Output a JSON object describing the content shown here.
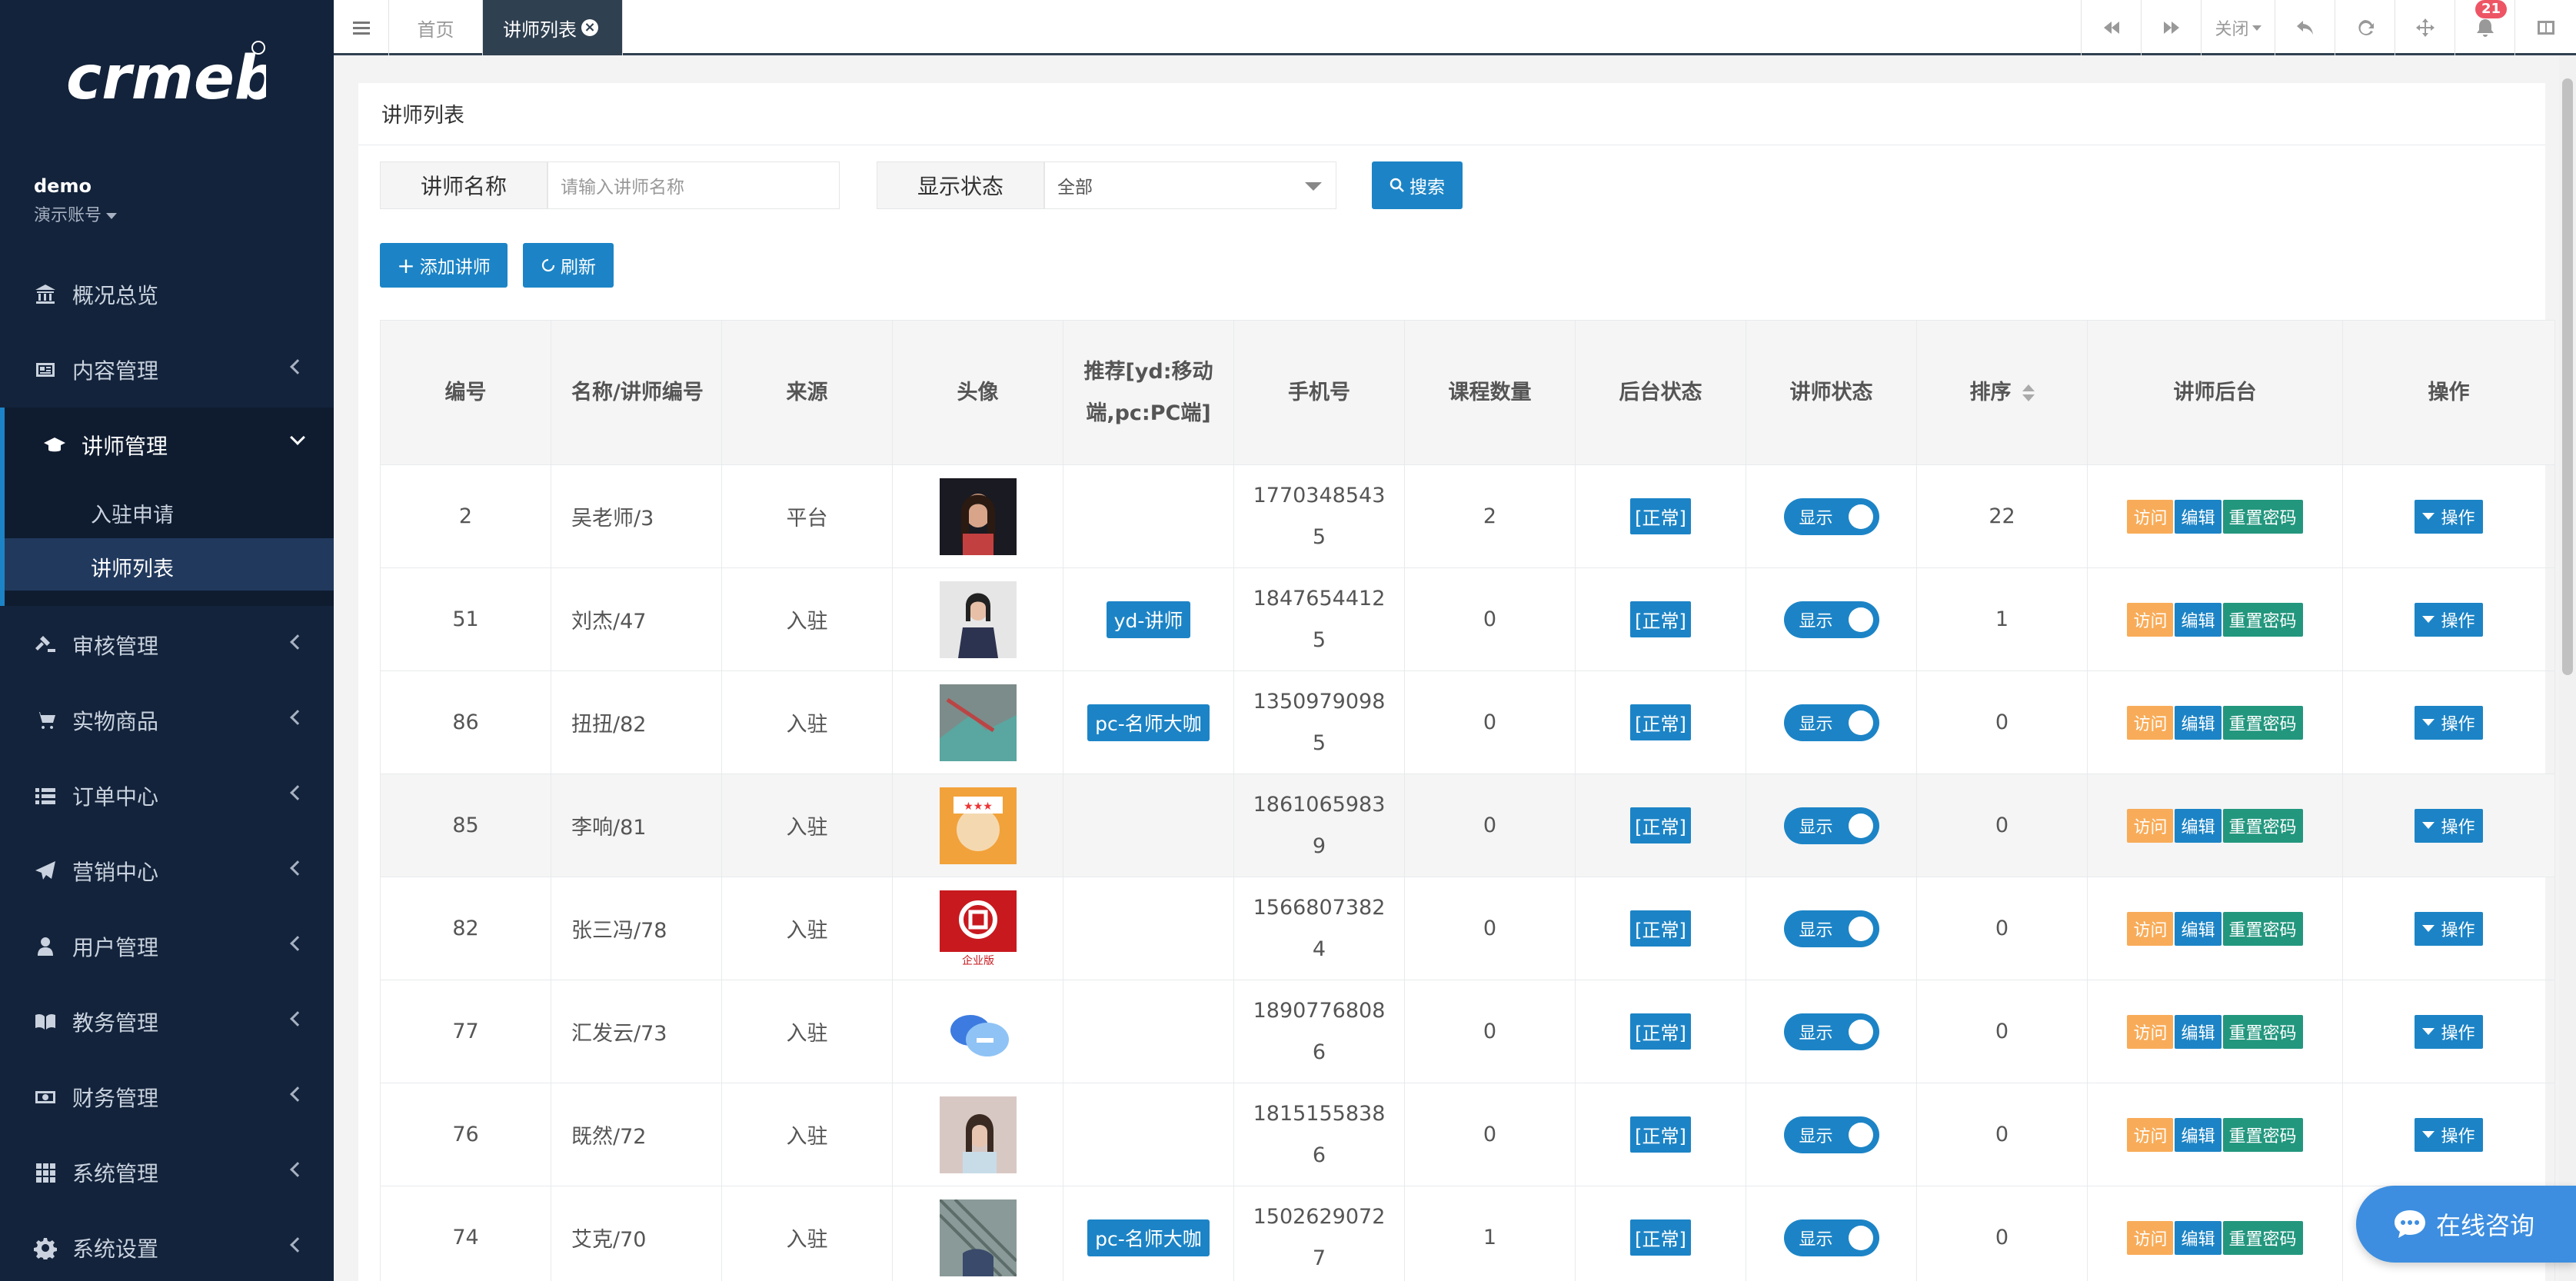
{
  "sidebar": {
    "brand": "crmeb",
    "user_name": "demo",
    "user_role": "演示账号",
    "nav": [
      {
        "label": "概况总览",
        "icon": "bank-icon"
      },
      {
        "label": "内容管理",
        "icon": "newspaper-icon"
      },
      {
        "label": "讲师管理",
        "icon": "graduation-cap-icon"
      },
      {
        "label": "审核管理",
        "icon": "gavel-icon"
      },
      {
        "label": "实物商品",
        "icon": "cart-icon"
      },
      {
        "label": "订单中心",
        "icon": "list-icon"
      },
      {
        "label": "营销中心",
        "icon": "paper-plane-icon"
      },
      {
        "label": "用户管理",
        "icon": "user-icon"
      },
      {
        "label": "教务管理",
        "icon": "book-icon"
      },
      {
        "label": "财务管理",
        "icon": "money-icon"
      },
      {
        "label": "系统管理",
        "icon": "grid-icon"
      },
      {
        "label": "系统设置",
        "icon": "gear-icon"
      }
    ],
    "sub_items": [
      "入驻申请",
      "讲师列表"
    ]
  },
  "topbar": {
    "tabs": [
      "首页",
      "讲师列表"
    ],
    "close_label": "关闭",
    "notification_count": "21"
  },
  "panel": {
    "title": "讲师列表",
    "filter_name_label": "讲师名称",
    "filter_name_placeholder": "请输入讲师名称",
    "filter_status_label": "显示状态",
    "filter_status_value": "全部",
    "search_button": "搜索",
    "add_button": "添加讲师",
    "refresh_button": "刷新"
  },
  "table": {
    "headers": [
      "编号",
      "名称/讲师编号",
      "来源",
      "头像",
      "推荐[yd:移动端,pc:PC端]",
      "手机号",
      "课程数量",
      "后台状态",
      "讲师状态",
      "排序",
      "讲师后台",
      "操作"
    ],
    "rows": [
      {
        "id": "2",
        "name": "吴老师/3",
        "source": "平台",
        "rec": "",
        "phone_a": "1770348543",
        "phone_b": "5",
        "courses": "2",
        "status": "[正常]",
        "show": "显示",
        "sort": "22"
      },
      {
        "id": "51",
        "name": "刘杰/47",
        "source": "入驻",
        "rec": "yd-讲师",
        "phone_a": "1847654412",
        "phone_b": "5",
        "courses": "0",
        "status": "[正常]",
        "show": "显示",
        "sort": "1"
      },
      {
        "id": "86",
        "name": "扭扭/82",
        "source": "入驻",
        "rec": "pc-名师大咖",
        "phone_a": "1350979098",
        "phone_b": "5",
        "courses": "0",
        "status": "[正常]",
        "show": "显示",
        "sort": "0"
      },
      {
        "id": "85",
        "name": "李响/81",
        "source": "入驻",
        "rec": "",
        "phone_a": "1861065983",
        "phone_b": "9",
        "courses": "0",
        "status": "[正常]",
        "show": "显示",
        "sort": "0"
      },
      {
        "id": "82",
        "name": "张三冯/78",
        "source": "入驻",
        "rec": "",
        "phone_a": "1566807382",
        "phone_b": "4",
        "courses": "0",
        "status": "[正常]",
        "show": "显示",
        "sort": "0"
      },
      {
        "id": "77",
        "name": "汇发云/73",
        "source": "入驻",
        "rec": "",
        "phone_a": "1890776808",
        "phone_b": "6",
        "courses": "0",
        "status": "[正常]",
        "show": "显示",
        "sort": "0"
      },
      {
        "id": "76",
        "name": "既然/72",
        "source": "入驻",
        "rec": "",
        "phone_a": "1815155838",
        "phone_b": "6",
        "courses": "0",
        "status": "[正常]",
        "show": "显示",
        "sort": "0"
      },
      {
        "id": "74",
        "name": "艾克/70",
        "source": "入驻",
        "rec": "pc-名师大咖",
        "phone_a": "1502629072",
        "phone_b": "7",
        "courses": "1",
        "status": "[正常]",
        "show": "显示",
        "sort": "0"
      }
    ],
    "action_visit": "访问",
    "action_edit": "编辑",
    "action_reset": "重置密码",
    "action_op": "操作",
    "enterprise_label": "企业版"
  },
  "chat": {
    "label": "在线咨询"
  },
  "colors": {
    "sidebar_bg": "#13233b",
    "primary": "#1c84c6",
    "warning": "#f8ac59",
    "success": "#23977e",
    "badge": "#ed5565"
  }
}
